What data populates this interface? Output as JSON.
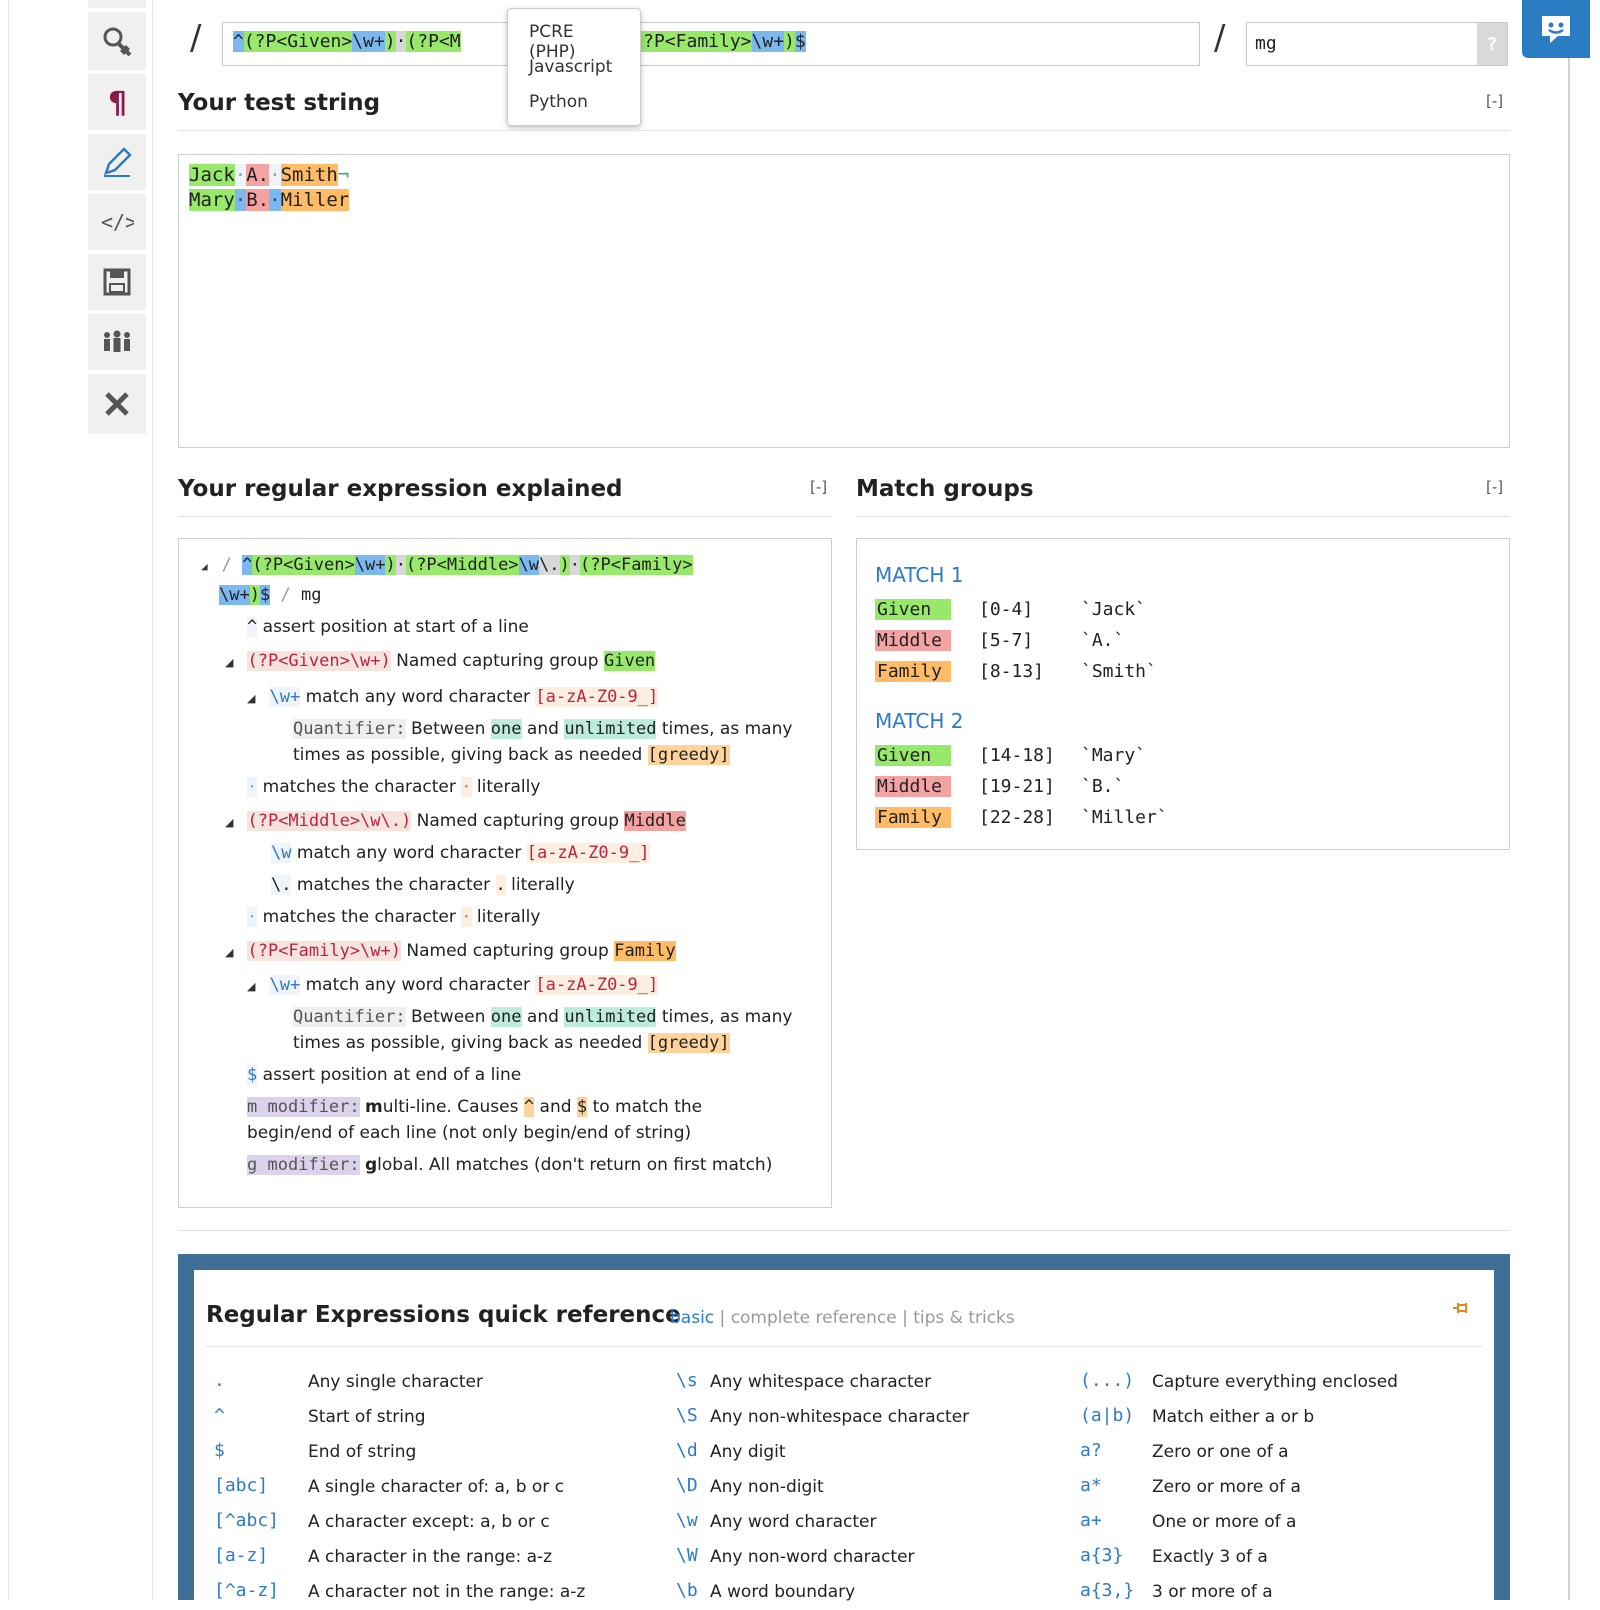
{
  "regex": {
    "value_parts": [
      "^",
      "(?P<Given>",
      "\\w+",
      ")",
      "·",
      "(?P<M",
      ")",
      "·",
      "(?P<Family>",
      "\\w+",
      ")",
      "$"
    ],
    "flags": "mg",
    "flag_help": "?"
  },
  "flavor_menu": [
    "PCRE (PHP)",
    "Javascript",
    "Python"
  ],
  "test_string": {
    "title": "Your test string",
    "collapse": "[-]",
    "line1": [
      "Jack",
      "·",
      "A.",
      "·",
      "Smith",
      "¬"
    ],
    "line2": [
      "Mary",
      "·",
      "B.",
      "·",
      "Miller"
    ]
  },
  "explain": {
    "title": "Your regular expression explained",
    "collapse": "[-]",
    "delim": "/",
    "flags": "mg",
    "rows": {
      "head_parts": [
        "^",
        "(?P<Given>",
        "\\w+",
        ")",
        "·",
        "(?P<Middle>",
        "\\w",
        "\\.",
        ")",
        "·",
        "(?P<Family>"
      ],
      "head_parts2": [
        "\\w+",
        ")",
        "$"
      ],
      "caret_sym": "^",
      "caret_text": "assert position at start of a line",
      "given_sym": "(?P<Given>\\w+)",
      "given_text": "Named capturing group",
      "given_name": "Given",
      "w1_sym": "\\w+",
      "w1_text": "match any word character",
      "w1_class": "[a-zA-Z0-9_]",
      "q1_label": "Quantifier:",
      "q1_between": "Between",
      "q1_one": "one",
      "q1_and": "and",
      "q1_unlimited": "unlimited",
      "q1_rest": "times, as many",
      "q1_line2": "times as possible, giving back as needed",
      "q1_greedy": "[greedy]",
      "sp1_sym": "·",
      "sp1_text": "matches the character",
      "sp1_char": "·",
      "sp1_lit": "literally",
      "middle_sym": "(?P<Middle>\\w\\.)",
      "middle_text": "Named capturing group",
      "middle_name": "Middle",
      "w2_sym": "\\w",
      "w2_text": "match any word character",
      "w2_class": "[a-zA-Z0-9_]",
      "dot_sym": "\\.",
      "dot_text": "matches the character",
      "dot_char": ".",
      "dot_lit": "literally",
      "sp2_sym": "·",
      "sp2_text": "matches the character",
      "sp2_char": "·",
      "sp2_lit": "literally",
      "family_sym": "(?P<Family>\\w+)",
      "family_text": "Named capturing group",
      "family_name": "Family",
      "w3_sym": "\\w+",
      "w3_text": "match any word character",
      "w3_class": "[a-zA-Z0-9_]",
      "q2_label": "Quantifier:",
      "q2_between": "Between",
      "q2_one": "one",
      "q2_and": "and",
      "q2_unlimited": "unlimited",
      "q2_rest": "times, as many",
      "q2_line2": "times as possible, giving back as needed",
      "q2_greedy": "[greedy]",
      "end_sym": "$",
      "end_text": "assert position at end of a line",
      "m_label": "m modifier:",
      "m_bold": "m",
      "m_text1": "ulti-line. Causes",
      "m_caret": "^",
      "m_and": "and",
      "m_dollar": "$",
      "m_text2": "to match the",
      "m_line2": "begin/end of each line (not only begin/end of string)",
      "g_label": "g modifier:",
      "g_bold": "g",
      "g_text": "lobal. All matches (don't return on first match)"
    }
  },
  "matches": {
    "title": "Match groups",
    "collapse": "[-]",
    "groups": [
      {
        "heading": "MATCH 1",
        "rows": [
          {
            "name": "Given",
            "range": "[0-4]",
            "value": "`Jack`"
          },
          {
            "name": "Middle",
            "range": "[5-7]",
            "value": "`A.`"
          },
          {
            "name": "Family",
            "range": "[8-13]",
            "value": "`Smith`"
          }
        ]
      },
      {
        "heading": "MATCH 2",
        "rows": [
          {
            "name": "Given",
            "range": "[14-18]",
            "value": "`Mary`"
          },
          {
            "name": "Middle",
            "range": "[19-21]",
            "value": "`B.`"
          },
          {
            "name": "Family",
            "range": "[22-28]",
            "value": "`Miller`"
          }
        ]
      }
    ]
  },
  "quickref": {
    "title": "Regular Expressions quick reference",
    "tab_basic": "basic",
    "sep": "|",
    "tab_complete": "complete reference",
    "tab_tips": "tips & tricks",
    "col1": [
      {
        "sym": ".",
        "desc": "Any single character"
      },
      {
        "sym": "^",
        "desc": "Start of string"
      },
      {
        "sym": "$",
        "desc": "End of string"
      },
      {
        "sym": "[abc]",
        "desc": "A single character of: a, b or c"
      },
      {
        "sym": "[^abc]",
        "desc": "A character except: a, b or c"
      },
      {
        "sym": "[a-z]",
        "desc": "A character in the range: a-z"
      },
      {
        "sym": "[^a-z]",
        "desc": "A character not in the range: a-z"
      }
    ],
    "col2": [
      {
        "sym": "\\s",
        "desc": "Any whitespace character"
      },
      {
        "sym": "\\S",
        "desc": "Any non-whitespace character"
      },
      {
        "sym": "\\d",
        "desc": "Any digit"
      },
      {
        "sym": "\\D",
        "desc": "Any non-digit"
      },
      {
        "sym": "\\w",
        "desc": "Any word character"
      },
      {
        "sym": "\\W",
        "desc": "Any non-word character"
      },
      {
        "sym": "\\b",
        "desc": "A word boundary"
      }
    ],
    "col3": [
      {
        "sym": "(...)",
        "desc": "Capture everything enclosed"
      },
      {
        "sym": "(a|b)",
        "desc": "Match either a or b"
      },
      {
        "sym": "a?",
        "desc": "Zero or one of a"
      },
      {
        "sym": "a*",
        "desc": "Zero or more of a"
      },
      {
        "sym": "a+",
        "desc": "One or more of a"
      },
      {
        "sym": "a{3}",
        "desc": "Exactly 3 of a"
      },
      {
        "sym": "a{3,}",
        "desc": "3 or more of a"
      }
    ]
  },
  "colors": {
    "accent": "#2c7ac9",
    "panel": "#3f6f98",
    "group_given": "#98e86c",
    "group_middle": "#f4a3a3",
    "group_family": "#ffbb66"
  }
}
